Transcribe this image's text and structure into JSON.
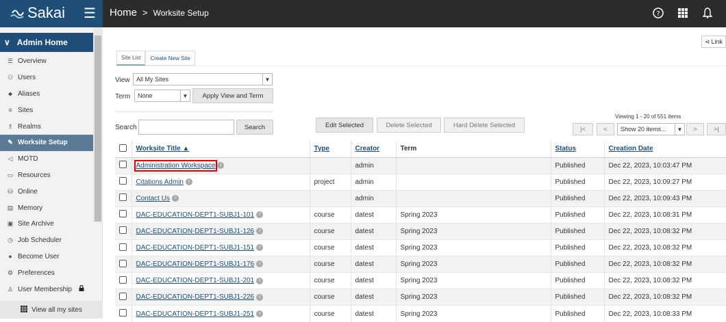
{
  "app": {
    "logo_text": "Sakai",
    "brand_color": "#1f4f78"
  },
  "breadcrumb": {
    "home": "Home",
    "separator": ">",
    "current": "Worksite Setup"
  },
  "top_icons": [
    "help-icon",
    "apps-grid-icon",
    "bell-icon"
  ],
  "sidebar": {
    "header": "Admin Home",
    "items": [
      {
        "label": "Overview",
        "icon": "list-icon"
      },
      {
        "label": "Users",
        "icon": "users-icon"
      },
      {
        "label": "Aliases",
        "icon": "tag-icon"
      },
      {
        "label": "Sites",
        "icon": "lines-icon"
      },
      {
        "label": "Realms",
        "icon": "sitemap-icon"
      },
      {
        "label": "Worksite Setup",
        "icon": "wrench-icon",
        "active": true
      },
      {
        "label": "MOTD",
        "icon": "megaphone-icon"
      },
      {
        "label": "Resources",
        "icon": "folder-icon"
      },
      {
        "label": "Online",
        "icon": "database-icon"
      },
      {
        "label": "Memory",
        "icon": "memory-icon"
      },
      {
        "label": "Site Archive",
        "icon": "archive-icon"
      },
      {
        "label": "Job Scheduler",
        "icon": "clock-icon"
      },
      {
        "label": "Become User",
        "icon": "user-secret-icon"
      },
      {
        "label": "Preferences",
        "icon": "gear-icon"
      },
      {
        "label": "User Membership",
        "icon": "user-icon",
        "locked": true
      }
    ],
    "footer": "View all my sites"
  },
  "main": {
    "link_label": "Link",
    "tabs": [
      {
        "label": "Site List",
        "active": true
      },
      {
        "label": "Create New Site"
      }
    ],
    "view_label": "View",
    "view_value": "All My Sites",
    "term_label": "Term",
    "term_value": "None",
    "apply_button": "Apply View and Term",
    "search_label": "Search",
    "search_button": "Search",
    "edit_selected": "Edit Selected",
    "delete_selected": "Delete Selected",
    "hard_delete_selected": "Hard Delete Selected",
    "viewing_text": "Viewing 1 - 20 of 551 items",
    "page_first": "|<",
    "page_prev": "<",
    "page_size": "Show 20 items...",
    "page_next": ">",
    "page_last": ">|"
  },
  "table": {
    "headers": {
      "title": "Worksite Title ▲",
      "type": "Type",
      "creator": "Creator",
      "term": "Term",
      "status": "Status",
      "created": "Creation Date"
    },
    "rows": [
      {
        "title": "Administration Workspace",
        "type": "",
        "creator": "admin",
        "term": "",
        "status": "Published",
        "created": "Dec 22, 2023, 10:03:47 PM",
        "highlight": true
      },
      {
        "title": "Citations Admin",
        "type": "project",
        "creator": "admin",
        "term": "",
        "status": "Published",
        "created": "Dec 22, 2023, 10:09:27 PM"
      },
      {
        "title": "Contact Us",
        "type": "",
        "creator": "admin",
        "term": "",
        "status": "Published",
        "created": "Dec 22, 2023, 10:09:43 PM"
      },
      {
        "title": "DAC-EDUCATION-DEPT1-SUBJ1-101",
        "type": "course",
        "creator": "datest",
        "term": "Spring 2023",
        "status": "Published",
        "created": "Dec 22, 2023, 10:08:31 PM"
      },
      {
        "title": "DAC-EDUCATION-DEPT1-SUBJ1-126",
        "type": "course",
        "creator": "datest",
        "term": "Spring 2023",
        "status": "Published",
        "created": "Dec 22, 2023, 10:08:32 PM"
      },
      {
        "title": "DAC-EDUCATION-DEPT1-SUBJ1-151",
        "type": "course",
        "creator": "datest",
        "term": "Spring 2023",
        "status": "Published",
        "created": "Dec 22, 2023, 10:08:32 PM"
      },
      {
        "title": "DAC-EDUCATION-DEPT1-SUBJ1-176",
        "type": "course",
        "creator": "datest",
        "term": "Spring 2023",
        "status": "Published",
        "created": "Dec 22, 2023, 10:08:32 PM"
      },
      {
        "title": "DAC-EDUCATION-DEPT1-SUBJ1-201",
        "type": "course",
        "creator": "datest",
        "term": "Spring 2023",
        "status": "Published",
        "created": "Dec 22, 2023, 10:08:32 PM"
      },
      {
        "title": "DAC-EDUCATION-DEPT1-SUBJ1-226",
        "type": "course",
        "creator": "datest",
        "term": "Spring 2023",
        "status": "Published",
        "created": "Dec 22, 2023, 10:08:32 PM"
      },
      {
        "title": "DAC-EDUCATION-DEPT1-SUBJ1-251",
        "type": "course",
        "creator": "datest",
        "term": "Spring 2023",
        "status": "Published",
        "created": "Dec 22, 2023, 10:08:33 PM"
      }
    ]
  }
}
